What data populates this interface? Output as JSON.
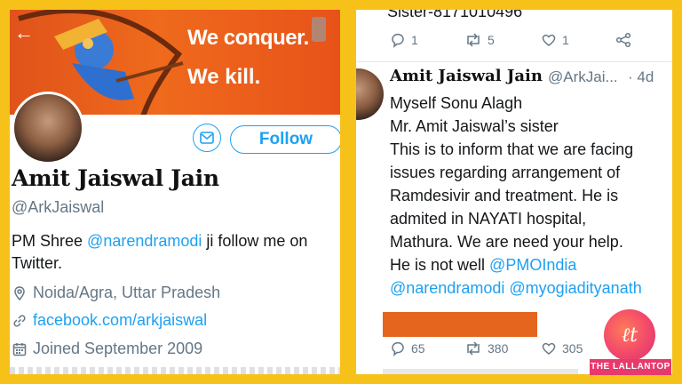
{
  "profile": {
    "banner_line1": "We conquer.",
    "banner_line2": "We kill.",
    "follow_label": "Follow",
    "name": "Amit Jaiswal Jain",
    "handle": "@ArkJaiswal",
    "bio_prefix": "PM Shree ",
    "bio_mention": "@narendramodi",
    "bio_suffix": " ji follow me on",
    "bio_line2": "Twitter.",
    "location": "Noida/Agra, Uttar Pradesh",
    "website": "facebook.com/arkjaiswal",
    "joined": "Joined September 2009"
  },
  "prev_tweet": {
    "text": "Sister-8171010496",
    "replies": "1",
    "retweets": "5",
    "likes": "1"
  },
  "tweet": {
    "name": "Amit Jaiswal Jain",
    "handle": "@ArkJai...",
    "age": "· 4d",
    "lines": [
      "Myself Sonu Alagh",
      "Mr. Amit Jaiswal’s sister",
      "This is to inform that we are facing",
      "issues regarding arrangement of",
      "Ramdesivir and treatment. He is",
      "admited in NAYATI hospital,",
      "Mathura. We are need your help."
    ],
    "line8_prefix": "He is not well ",
    "mention1": "@PMOIndia",
    "mention2": "@narendramodi",
    "mention3": "@myogiadityanath",
    "replies": "65",
    "retweets": "380",
    "likes": "305"
  },
  "logo": {
    "mark": "ℓt",
    "tag": "THE LALLANTOP"
  },
  "colors": {
    "frame": "#f6c21a",
    "twitter_blue": "#1da1f2",
    "banner_orange": "#e8521a",
    "redaction": "#e5651f",
    "logo_pink": "#e8396c"
  },
  "icons": [
    "back-arrow-icon",
    "mail-icon",
    "location-icon",
    "link-icon",
    "calendar-icon",
    "reply-icon",
    "retweet-icon",
    "like-icon",
    "share-icon"
  ]
}
